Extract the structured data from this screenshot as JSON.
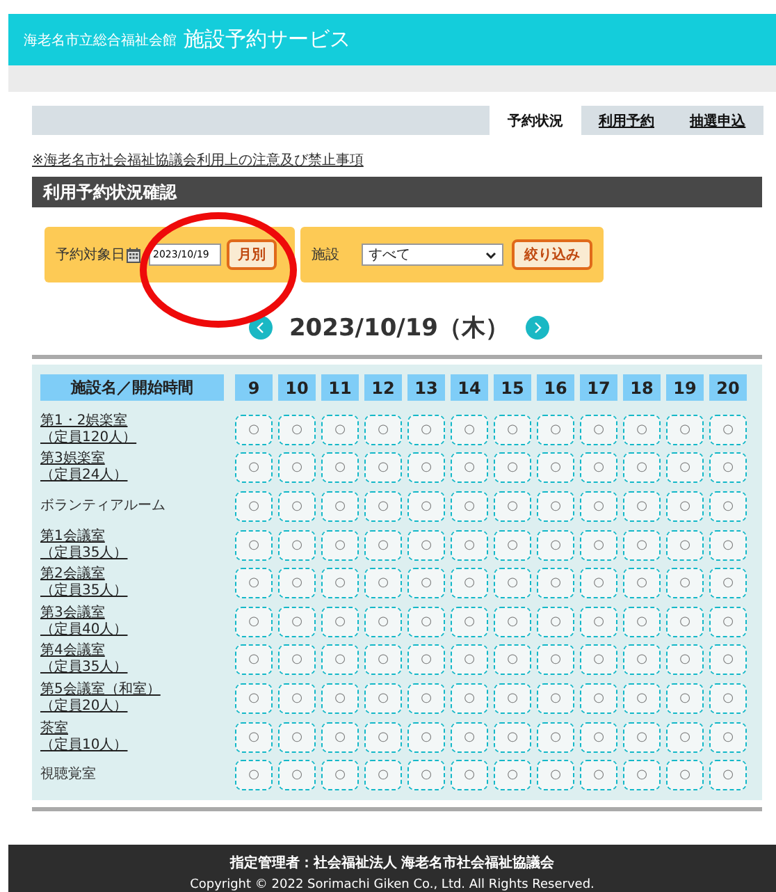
{
  "header": {
    "org": "海老名市立総合福祉会館",
    "title": "施設予約サービス"
  },
  "tabs": [
    {
      "label": "予約状況",
      "selected": true
    },
    {
      "label": "利用予約",
      "selected": false
    },
    {
      "label": "抽選申込",
      "selected": false
    }
  ],
  "notice_link": "※海老名市社会福祉協議会利用上の注意及び禁止事項",
  "section_title": "利用予約状況確認",
  "filter": {
    "date_label": "予約対象日",
    "date_value": "2023/10/19",
    "month_button": "月別",
    "facility_label": "施設",
    "facility_value": "すべて",
    "filter_button": "絞り込み"
  },
  "date_nav": {
    "date": "2023/10/19（木）"
  },
  "grid": {
    "corner": "施設名／開始時間",
    "hours": [
      "9",
      "10",
      "11",
      "12",
      "13",
      "14",
      "15",
      "16",
      "17",
      "18",
      "19",
      "20"
    ],
    "rows": [
      {
        "name": "第1・2娯楽室",
        "capacity": "（定員120人）",
        "link": true,
        "slots": [
          "○",
          "○",
          "○",
          "○",
          "○",
          "○",
          "○",
          "○",
          "○",
          "○",
          "○",
          "○"
        ]
      },
      {
        "name": "第3娯楽室",
        "capacity": "（定員24人）",
        "link": true,
        "slots": [
          "○",
          "○",
          "○",
          "○",
          "○",
          "○",
          "○",
          "○",
          "○",
          "○",
          "○",
          "○"
        ]
      },
      {
        "name": "ボランティアルーム",
        "link": false,
        "slots": [
          "○",
          "○",
          "○",
          "○",
          "○",
          "○",
          "○",
          "○",
          "○",
          "○",
          "○",
          "○"
        ]
      },
      {
        "name": "第1会議室",
        "capacity": "（定員35人）",
        "link": true,
        "slots": [
          "○",
          "○",
          "○",
          "○",
          "○",
          "○",
          "○",
          "○",
          "○",
          "○",
          "○",
          "○"
        ]
      },
      {
        "name": "第2会議室",
        "capacity": "（定員35人）",
        "link": true,
        "slots": [
          "○",
          "○",
          "○",
          "○",
          "○",
          "○",
          "○",
          "○",
          "○",
          "○",
          "○",
          "○"
        ]
      },
      {
        "name": "第3会議室",
        "capacity": "（定員40人）",
        "link": true,
        "slots": [
          "○",
          "○",
          "○",
          "○",
          "○",
          "○",
          "○",
          "○",
          "○",
          "○",
          "○",
          "○"
        ]
      },
      {
        "name": "第4会議室",
        "capacity": "（定員35人）",
        "link": true,
        "slots": [
          "○",
          "○",
          "○",
          "○",
          "○",
          "○",
          "○",
          "○",
          "○",
          "○",
          "○",
          "○"
        ]
      },
      {
        "name": "第5会議室（和室）",
        "capacity": "（定員20人）",
        "link": true,
        "slots": [
          "○",
          "○",
          "○",
          "○",
          "○",
          "○",
          "○",
          "○",
          "○",
          "○",
          "○",
          "○"
        ]
      },
      {
        "name": "茶室",
        "capacity": "（定員10人）",
        "link": true,
        "slots": [
          "○",
          "○",
          "○",
          "○",
          "○",
          "○",
          "○",
          "○",
          "○",
          "○",
          "○",
          "○"
        ]
      },
      {
        "name": "視聴覚室",
        "link": false,
        "slots": [
          "○",
          "○",
          "○",
          "○",
          "○",
          "○",
          "○",
          "○",
          "○",
          "○",
          "○",
          "○"
        ]
      }
    ]
  },
  "footer": {
    "manager": "指定管理者：社会福祉法人 海老名市社会福祉協議会",
    "copyright": "Copyright © 2022 Sorimachi Giken Co., Ltd. All Rights Reserved."
  }
}
